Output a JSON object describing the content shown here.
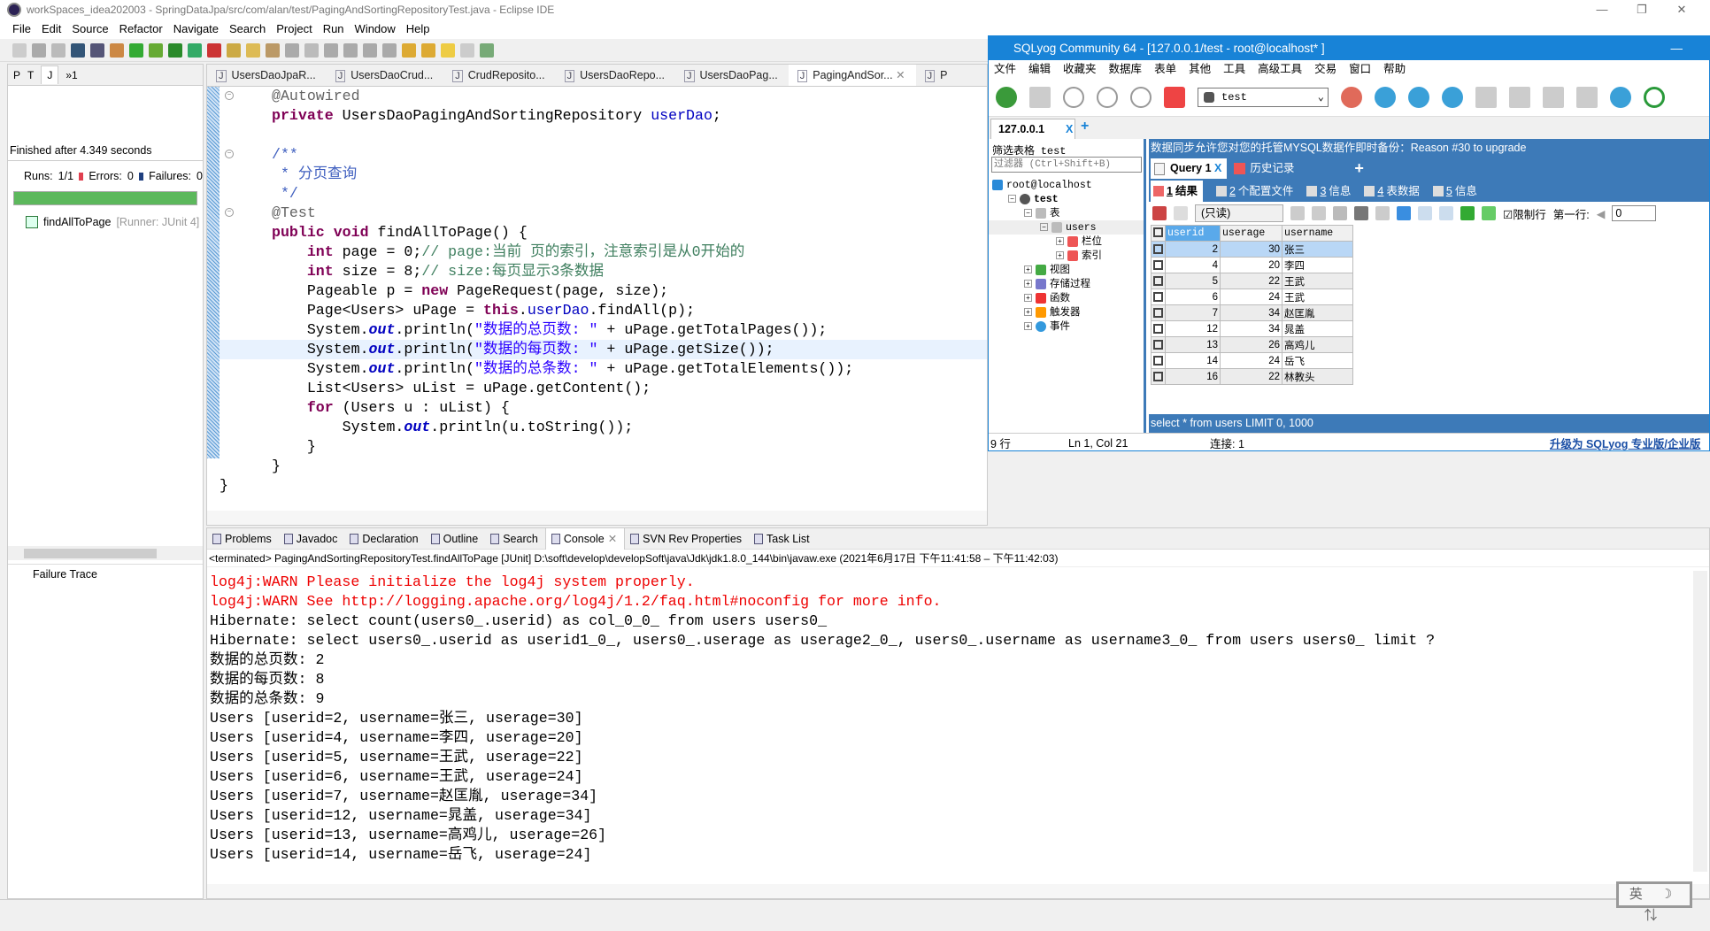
{
  "window": {
    "title": "workSpaces_idea202003 - SpringDataJpa/src/com/alan/test/PagingAndSortingRepositoryTest.java - Eclipse IDE",
    "minimize": "—",
    "restore": "❐",
    "close": "✕"
  },
  "menu": [
    "File",
    "Edit",
    "Source",
    "Refactor",
    "Navigate",
    "Search",
    "Project",
    "Run",
    "Window",
    "Help"
  ],
  "left_panel": {
    "tabs": [
      "P",
      "T",
      "J"
    ],
    "overflow": "»1",
    "status": "Finished after 4.349 seconds",
    "runs_label": "Runs:",
    "runs": "1/1",
    "errors_label": "Errors:",
    "errors": "0",
    "failures_label": "Failures:",
    "failures": "0",
    "progress_percent": 100,
    "progress_color": "#5cb85c",
    "test_name": "findAllToPage",
    "test_runner": "[Runner: JUnit 4]",
    "failure_trace": "Failure Trace"
  },
  "editor": {
    "tabs": [
      "UsersDaoJpaR...",
      "UsersDaoCrud...",
      "CrudReposito...",
      "UsersDaoRepo...",
      "UsersDaoPag...",
      "PagingAndSor...",
      "P"
    ],
    "active_tab": 5,
    "lines": [
      {
        "fold": true,
        "segs": [
          {
            "c": "an",
            "t": "@Autowired"
          }
        ]
      },
      {
        "segs": [
          {
            "c": "kw",
            "t": "private"
          },
          {
            "t": " UsersDaoPagingAndSortingRepository "
          },
          {
            "c": "fld",
            "t": "userDao"
          },
          {
            "t": ";"
          }
        ]
      },
      {
        "segs": []
      },
      {
        "fold": true,
        "segs": [
          {
            "c": "jd",
            "t": "/**"
          }
        ]
      },
      {
        "segs": [
          {
            "c": "jd",
            "t": " * 分页查询"
          }
        ]
      },
      {
        "segs": [
          {
            "c": "jd",
            "t": " */"
          }
        ]
      },
      {
        "fold": true,
        "segs": [
          {
            "c": "an",
            "t": "@Test"
          }
        ]
      },
      {
        "segs": [
          {
            "c": "kw",
            "t": "public"
          },
          {
            "t": " "
          },
          {
            "c": "kw",
            "t": "void"
          },
          {
            "t": " findAllToPage() {"
          }
        ]
      },
      {
        "segs": [
          {
            "t": "    "
          },
          {
            "c": "kw",
            "t": "int"
          },
          {
            "t": " page = 0;"
          },
          {
            "c": "cm",
            "t": "// page:当前 页的索引，注意索引是从0开始的"
          }
        ]
      },
      {
        "segs": [
          {
            "t": "    "
          },
          {
            "c": "kw",
            "t": "int"
          },
          {
            "t": " size = 8;"
          },
          {
            "c": "cm",
            "t": "// size:每页显示3条数据"
          }
        ]
      },
      {
        "segs": [
          {
            "t": "    Pageable p = "
          },
          {
            "c": "kw",
            "t": "new"
          },
          {
            "t": " PageRequest(page, size);"
          }
        ]
      },
      {
        "segs": [
          {
            "t": "    Page<Users> uPage = "
          },
          {
            "c": "kw",
            "t": "this"
          },
          {
            "t": "."
          },
          {
            "c": "fld",
            "t": "userDao"
          },
          {
            "t": ".findAll(p);"
          }
        ]
      },
      {
        "segs": [
          {
            "t": "    System."
          },
          {
            "c": "sfld",
            "t": "out"
          },
          {
            "t": ".println("
          },
          {
            "c": "str",
            "t": "\"数据的总页数: \""
          },
          {
            "t": " + uPage.getTotalPages());"
          }
        ]
      },
      {
        "hl": true,
        "segs": [
          {
            "t": "    System."
          },
          {
            "c": "sfld",
            "t": "out"
          },
          {
            "t": ".println("
          },
          {
            "c": "str",
            "t": "\"数据的每页数: \""
          },
          {
            "t": " + uPage.getSize());"
          }
        ]
      },
      {
        "segs": [
          {
            "t": "    System."
          },
          {
            "c": "sfld",
            "t": "out"
          },
          {
            "t": ".println("
          },
          {
            "c": "str",
            "t": "\"数据的总条数: \""
          },
          {
            "t": " + uPage.getTotalElements());"
          }
        ]
      },
      {
        "segs": [
          {
            "t": "    List<Users> uList = uPage.getContent();"
          }
        ]
      },
      {
        "segs": [
          {
            "t": "    "
          },
          {
            "c": "kw",
            "t": "for"
          },
          {
            "t": " (Users u : uList) {"
          }
        ]
      },
      {
        "segs": [
          {
            "t": "        System."
          },
          {
            "c": "sfld",
            "t": "out"
          },
          {
            "t": ".println(u.toString());"
          }
        ]
      },
      {
        "segs": [
          {
            "t": "    }"
          }
        ]
      },
      {
        "segs": [
          {
            "t": "}"
          }
        ]
      },
      {
        "segs": [
          {
            "t": "}"
          }
        ],
        "outdent": true
      }
    ]
  },
  "bottom_panel": {
    "tabs": [
      "Problems",
      "Javadoc",
      "Declaration",
      "Outline",
      "Search",
      "Console",
      "SVN Rev Properties",
      "Task List"
    ],
    "active_tab": 5,
    "terminated": "<terminated> PagingAndSortingRepositoryTest.findAllToPage [JUnit] D:\\soft\\develop\\developSoft\\java\\Jdk\\jdk1.8.0_144\\bin\\javaw.exe  (2021年6月17日 下午11:41:58 – 下午11:42:03)",
    "console": [
      {
        "err": true,
        "t": "log4j:WARN Please initialize the log4j system properly."
      },
      {
        "err": true,
        "t": "log4j:WARN See http://logging.apache.org/log4j/1.2/faq.html#noconfig for more info."
      },
      {
        "t": "Hibernate: select count(users0_.userid) as col_0_0_ from users users0_"
      },
      {
        "t": "Hibernate: select users0_.userid as userid1_0_, users0_.userage as userage2_0_, users0_.username as username3_0_ from users users0_ limit ?"
      },
      {
        "t": "数据的总页数: 2"
      },
      {
        "t": "数据的每页数: 8"
      },
      {
        "t": "数据的总条数: 9"
      },
      {
        "t": "Users [userid=2, username=张三, userage=30]"
      },
      {
        "t": "Users [userid=4, username=李四, userage=20]"
      },
      {
        "t": "Users [userid=5, username=王武, userage=22]"
      },
      {
        "t": "Users [userid=6, username=王武, userage=24]"
      },
      {
        "t": "Users [userid=7, username=赵匡胤, userage=34]"
      },
      {
        "t": "Users [userid=12, username=晁盖, userage=34]"
      },
      {
        "t": "Users [userid=13, username=高鸡儿, userage=26]"
      },
      {
        "t": "Users [userid=14, username=岳飞, userage=24]"
      }
    ]
  },
  "ime": "英 ☽ ⇅",
  "sqlyog": {
    "title": "SQLyog Community 64 - [127.0.0.1/test - root@localhost* ]",
    "minimize": "—",
    "menu": [
      "文件",
      "编辑",
      "收藏夹",
      "数据库",
      "表单",
      "其他",
      "工具",
      "高级工具",
      "交易",
      "窗口",
      "帮助"
    ],
    "db_select": "test",
    "conn_tab": "127.0.0.1",
    "conn_close": "X",
    "conn_add": "+",
    "filter_label": "筛选表格",
    "filter_db": "test",
    "filter_placeholder": "过滤器 (Ctrl+Shift+B)",
    "tree": [
      {
        "lvl": 0,
        "label": "root@localhost",
        "icon": "server",
        "pm": ""
      },
      {
        "lvl": 1,
        "label": "test",
        "icon": "database",
        "pm": "−",
        "bold": true
      },
      {
        "lvl": 2,
        "label": "表",
        "icon": "table",
        "pm": "−"
      },
      {
        "lvl": 3,
        "label": "users",
        "icon": "table",
        "pm": "−",
        "sel": true
      },
      {
        "lvl": 4,
        "label": "栏位",
        "icon": "columns",
        "pm": "+"
      },
      {
        "lvl": 4,
        "label": "索引",
        "icon": "index",
        "pm": "+"
      },
      {
        "lvl": 2,
        "label": "视图",
        "icon": "view",
        "pm": "+"
      },
      {
        "lvl": 2,
        "label": "存储过程",
        "icon": "gear",
        "pm": "+"
      },
      {
        "lvl": 2,
        "label": "函数",
        "icon": "function",
        "pm": "+"
      },
      {
        "lvl": 2,
        "label": "触发器",
        "icon": "lightning",
        "pm": "+"
      },
      {
        "lvl": 2,
        "label": "事件",
        "icon": "clock",
        "pm": "+"
      }
    ],
    "banner": "数据同步允许您对您的托管MYSQL数据作即时备份：Reason #30 to upgrade",
    "query_tab": "Query 1",
    "query_close": "X",
    "history_tab": "历史记录",
    "add_tab": "+",
    "result_tabs": [
      {
        "n": "1",
        "l": "结果"
      },
      {
        "n": "2",
        "l": "个配置文件"
      },
      {
        "n": "3",
        "l": "信息"
      },
      {
        "n": "4",
        "l": "表数据"
      },
      {
        "n": "5",
        "l": "信息"
      }
    ],
    "mode": "(只读)",
    "limit_label": "限制行",
    "limit_checked": true,
    "first_row_label": "第一行:",
    "first_row": "0",
    "columns": [
      "userid",
      "userage",
      "username"
    ],
    "rows": [
      [
        "2",
        "30",
        "张三"
      ],
      [
        "4",
        "20",
        "李四"
      ],
      [
        "5",
        "22",
        "王武"
      ],
      [
        "6",
        "24",
        "王武"
      ],
      [
        "7",
        "34",
        "赵匡胤"
      ],
      [
        "12",
        "34",
        "晁盖"
      ],
      [
        "13",
        "26",
        "高鸡儿"
      ],
      [
        "14",
        "24",
        "岳飞"
      ],
      [
        "16",
        "22",
        "林教头"
      ]
    ],
    "query_text": "select * from users LIMIT 0, 1000",
    "status": {
      "rows": "9 行",
      "pos": "Ln 1, Col 21",
      "conn": "连接: 1",
      "upgrade": "升级为 SQLyog 专业版/企业版"
    },
    "accent": "#1883d7",
    "panel_blue": "#3d7ab8"
  }
}
